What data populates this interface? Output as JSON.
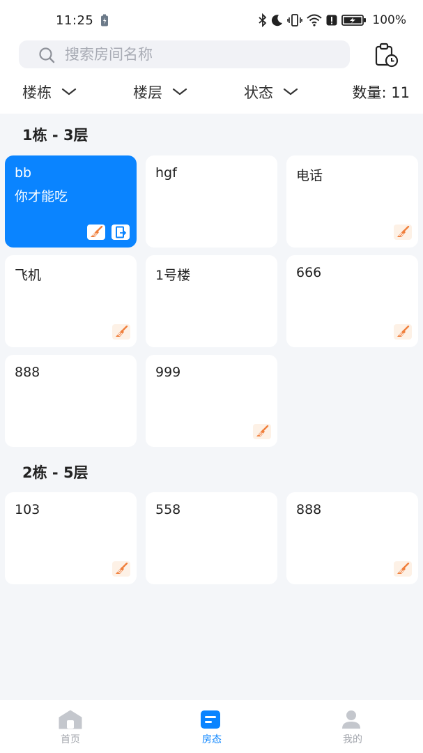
{
  "status_bar": {
    "time": "11:25",
    "battery": "100%"
  },
  "search": {
    "placeholder": "搜索房间名称",
    "value": ""
  },
  "filters": {
    "building": "楼栋",
    "floor": "楼层",
    "status": "状态",
    "count": "数量: 11"
  },
  "sections": [
    {
      "title": "1栋 - 3层",
      "rooms": [
        {
          "name": "bb",
          "note": "你才能吃",
          "active": true,
          "clean_icon": true,
          "checkout_icon": true
        },
        {
          "name": "hgf",
          "note": "",
          "active": false,
          "clean_icon": false,
          "checkout_icon": false
        },
        {
          "name": "电话",
          "note": "",
          "active": false,
          "clean_icon": true,
          "checkout_icon": false
        },
        {
          "name": "飞机",
          "note": "",
          "active": false,
          "clean_icon": true,
          "checkout_icon": false
        },
        {
          "name": "1号楼",
          "note": "",
          "active": false,
          "clean_icon": false,
          "checkout_icon": false
        },
        {
          "name": "666",
          "note": "",
          "active": false,
          "clean_icon": true,
          "checkout_icon": false
        },
        {
          "name": "888",
          "note": "",
          "active": false,
          "clean_icon": false,
          "checkout_icon": false
        },
        {
          "name": "999",
          "note": "",
          "active": false,
          "clean_icon": true,
          "checkout_icon": false
        }
      ]
    },
    {
      "title": "2栋 - 5层",
      "rooms": [
        {
          "name": "103",
          "note": "",
          "active": false,
          "clean_icon": true,
          "checkout_icon": false
        },
        {
          "name": "558",
          "note": "",
          "active": false,
          "clean_icon": false,
          "checkout_icon": false
        },
        {
          "name": "888",
          "note": "",
          "active": false,
          "clean_icon": true,
          "checkout_icon": false
        }
      ]
    }
  ],
  "tabbar": [
    {
      "label": "首页",
      "icon": "home-icon",
      "active": false
    },
    {
      "label": "房态",
      "icon": "room-status-icon",
      "active": true
    },
    {
      "label": "我的",
      "icon": "profile-icon",
      "active": false
    }
  ],
  "colors": {
    "accent": "#0a84ff",
    "clean_icon": "#f07f3c",
    "background": "#f4f6f9"
  }
}
